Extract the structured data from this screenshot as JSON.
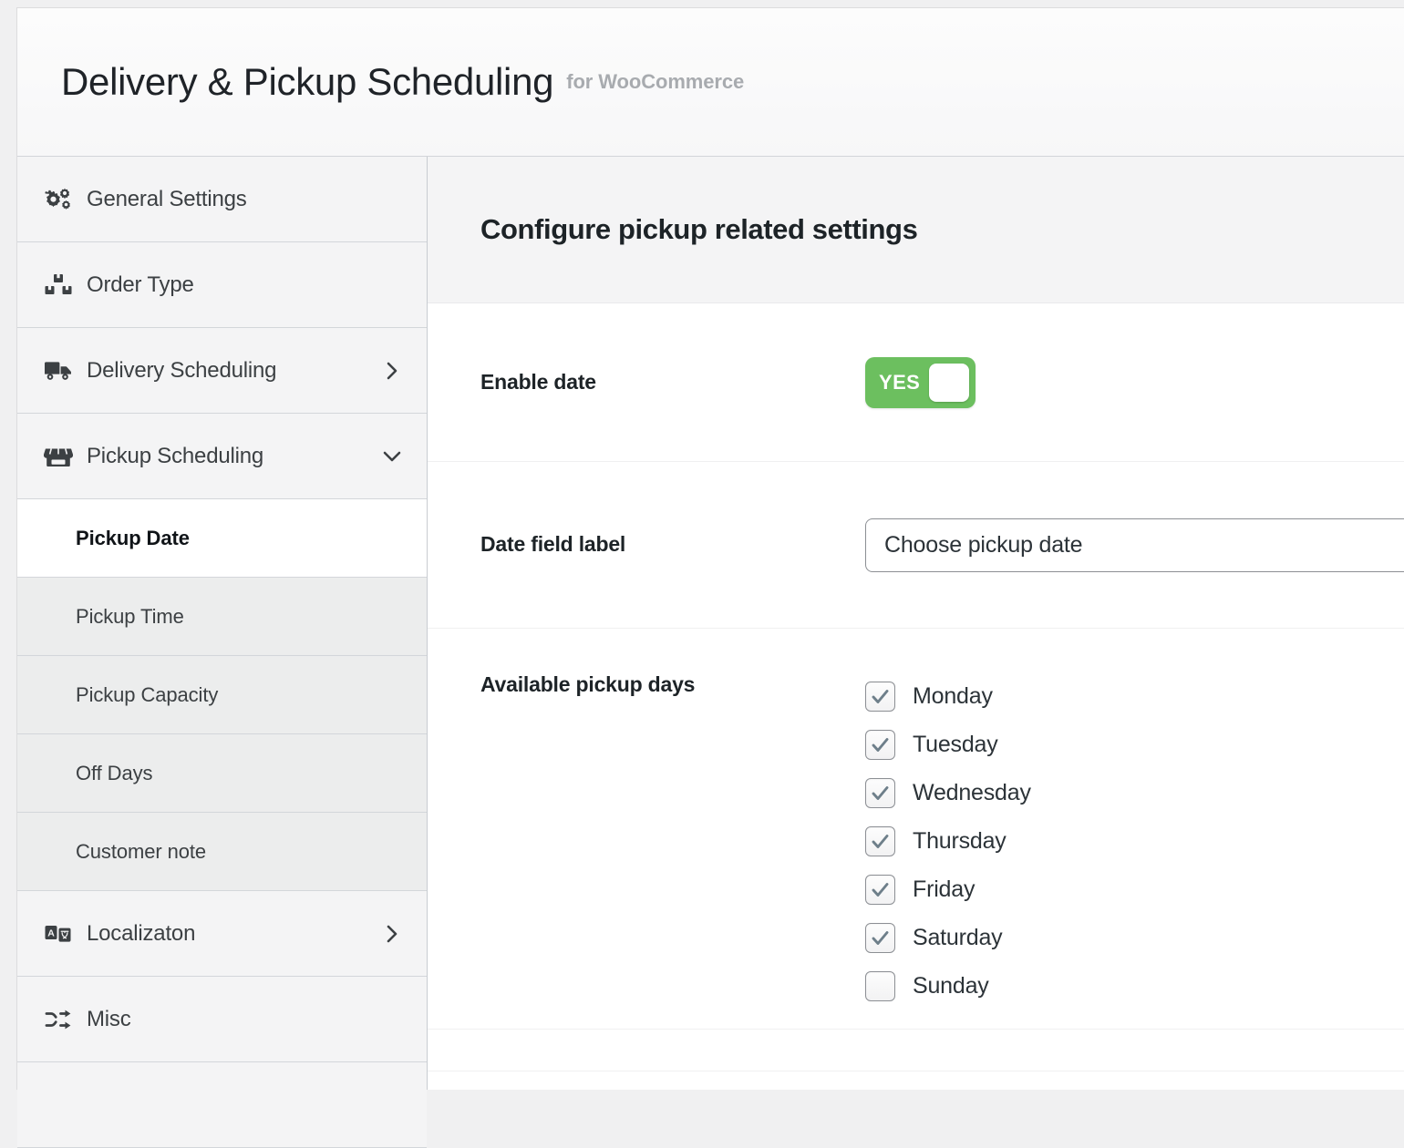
{
  "masthead": {
    "title": "Delivery & Pickup Scheduling",
    "subtitle": "for WooCommerce"
  },
  "sidebar": {
    "items": [
      {
        "label": "General Settings",
        "icon": "cogs-icon",
        "arrow": ""
      },
      {
        "label": "Order Type",
        "icon": "boxes-icon",
        "arrow": ""
      },
      {
        "label": "Delivery Scheduling",
        "icon": "truck-icon",
        "arrow": "chevron-right"
      },
      {
        "label": "Pickup Scheduling",
        "icon": "store-icon",
        "arrow": "chevron-down"
      }
    ],
    "sub_items": [
      {
        "label": "Pickup Date",
        "active": true
      },
      {
        "label": "Pickup Time",
        "active": false
      },
      {
        "label": "Pickup Capacity",
        "active": false
      },
      {
        "label": "Off Days",
        "active": false
      },
      {
        "label": "Customer note",
        "active": false
      }
    ],
    "items_bottom": [
      {
        "label": "Localizaton",
        "icon": "translate-icon",
        "arrow": "chevron-right"
      },
      {
        "label": "Misc",
        "icon": "shuffle-icon",
        "arrow": ""
      }
    ]
  },
  "main": {
    "heading": "Configure pickup related settings",
    "enable_date": {
      "label": "Enable date",
      "toggle_text": "YES",
      "enabled": true,
      "color": "#6cbf5f"
    },
    "date_field": {
      "label": "Date field label",
      "value": "Choose pickup date",
      "placeholder": "Choose pickup date"
    },
    "available_days": {
      "label": "Available pickup days",
      "days": [
        {
          "label": "Monday",
          "checked": true
        },
        {
          "label": "Tuesday",
          "checked": true
        },
        {
          "label": "Wednesday",
          "checked": true
        },
        {
          "label": "Thursday",
          "checked": true
        },
        {
          "label": "Friday",
          "checked": true
        },
        {
          "label": "Saturday",
          "checked": true
        },
        {
          "label": "Sunday",
          "checked": false
        }
      ]
    }
  },
  "colors": {
    "accent_green": "#6cbf5f",
    "checkmark": "#6e7f8a",
    "page_bg": "#f0f0f1",
    "sidebar_bg": "#f4f4f5",
    "subitem_bg": "#eceded"
  }
}
